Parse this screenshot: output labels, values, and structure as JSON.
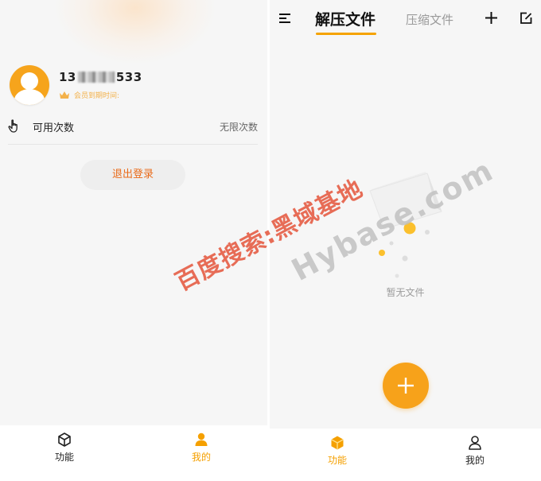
{
  "profile": {
    "phone_prefix": "13",
    "phone_suffix": "533",
    "vip_label": "会员到期时间:",
    "usage_label": "可用次数",
    "usage_value": "无限次数",
    "logout_label": "退出登录"
  },
  "header": {
    "tab_active": "解压文件",
    "tab_inactive": "压缩文件"
  },
  "empty_state": {
    "message": "暂无文件"
  },
  "bottom_nav": {
    "function_label": "功能",
    "mine_label": "我的"
  },
  "watermark": {
    "text_cn": "百度搜索:黑域基地",
    "text_en": "Hybase.com"
  },
  "colors": {
    "accent": "#f5a300",
    "logout_text": "#e96a18",
    "watermark_red": "#e4543a",
    "vip_gold": "#f3b14a"
  }
}
